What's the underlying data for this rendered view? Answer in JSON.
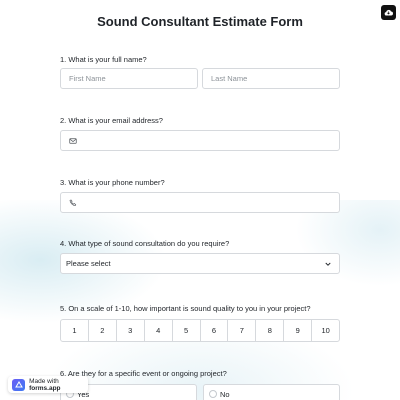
{
  "form": {
    "title": "Sound Consultant Estimate Form"
  },
  "questions": {
    "q1": {
      "label": "1.  What is your full name?",
      "first_name_placeholder": "First Name",
      "last_name_placeholder": "Last Name"
    },
    "q2": {
      "label": "2. What is your email address?",
      "icon": "envelope-icon"
    },
    "q3": {
      "label": "3. What is your phone number?",
      "icon": "phone-icon"
    },
    "q4": {
      "label": "4. What type of sound consultation do you require?",
      "selected": "Please select",
      "icon": "chevron-down-icon"
    },
    "q5": {
      "label": "5. On a scale of 1-10, how important is sound quality to you in your project?",
      "options": [
        "1",
        "2",
        "3",
        "4",
        "5",
        "6",
        "7",
        "8",
        "9",
        "10"
      ]
    },
    "q6": {
      "label": "6. Are they for a specific event or ongoing project?",
      "options": [
        "Yes",
        "No"
      ]
    }
  },
  "badge": {
    "prefix": "Made with",
    "brand": "forms.app"
  },
  "colors": {
    "border": "#d6d9dd",
    "badge_gradient_start": "#6a5cf5",
    "badge_gradient_end": "#3e7bf2"
  }
}
